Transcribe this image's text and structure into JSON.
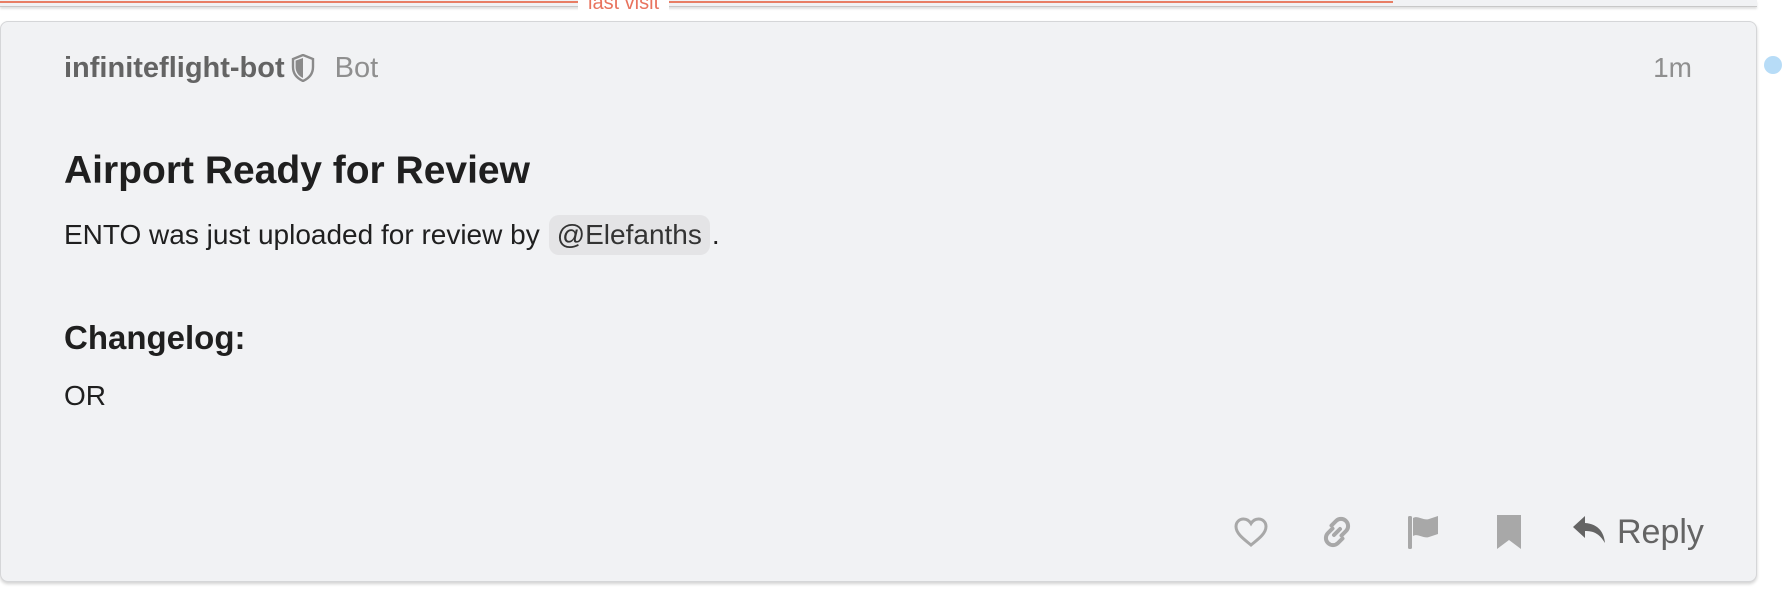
{
  "divider": {
    "label": "last visit"
  },
  "post": {
    "author": "infiniteflight-bot",
    "author_title": "Bot",
    "timestamp": "1m",
    "heading": "Airport Ready for Review",
    "body_prefix": "ENTO was just uploaded for review by",
    "mention": "@Elefanths",
    "body_suffix": ".",
    "changelog_heading": "Changelog:",
    "changelog_body": "OR"
  },
  "actions": {
    "like_icon": "heart-icon",
    "share_icon": "link-icon",
    "flag_icon": "flag-icon",
    "bookmark_icon": "bookmark-icon",
    "reply_label": "Reply"
  },
  "colors": {
    "last_visit_accent": "#e45735",
    "card_background": "#f1f2f4",
    "unread_dot": "#b7dcf7",
    "muted_text": "#8f8f8f"
  }
}
